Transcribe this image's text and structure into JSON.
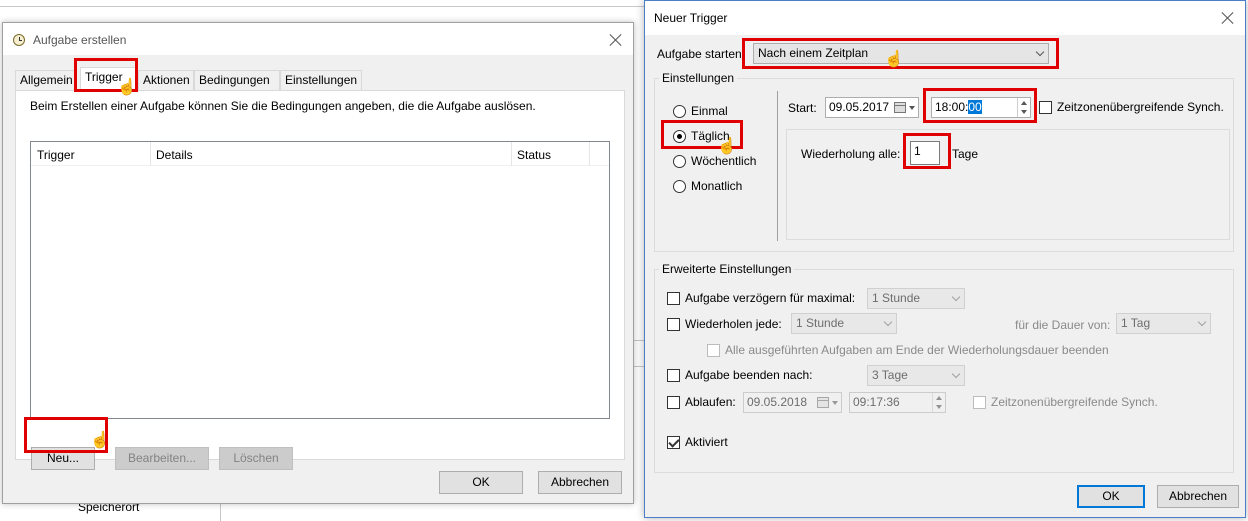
{
  "background": {
    "storage_label": "Speicherort"
  },
  "task_dialog": {
    "title": "Aufgabe erstellen",
    "tabs": [
      "Allgemein",
      "Trigger",
      "Aktionen",
      "Bedingungen",
      "Einstellungen"
    ],
    "active_tab": "Trigger",
    "description": "Beim Erstellen einer Aufgabe können Sie die Bedingungen angeben, die die Aufgabe auslösen.",
    "columns": [
      "Trigger",
      "Details",
      "Status"
    ],
    "buttons": {
      "new": "Neu...",
      "edit": "Bearbeiten...",
      "delete": "Löschen",
      "ok": "OK",
      "cancel": "Abbrechen"
    }
  },
  "trigger_dialog": {
    "title": "Neuer Trigger",
    "start_task_label": "Aufgabe starten:",
    "start_task_value": "Nach einem Zeitplan",
    "settings_group": "Einstellungen",
    "schedule_options": [
      "Einmal",
      "Täglich",
      "Wöchentlich",
      "Monatlich"
    ],
    "selected_schedule": "Täglich",
    "start_label": "Start:",
    "start_date": "09.05.2017",
    "start_time_prefix": "18:00:",
    "start_time_selected": "00",
    "sync_timezones_label": "Zeitzonenübergreifende Synch.",
    "repeat_every_label": "Wiederholung alle:",
    "repeat_every_value": "1",
    "repeat_unit": "Tage",
    "advanced_group": "Erweiterte Einstellungen",
    "delay_label": "Aufgabe verzögern für maximal:",
    "delay_value": "1 Stunde",
    "repeat_label": "Wiederholen jede:",
    "repeat_value": "1 Stunde",
    "duration_label": "für die Dauer von:",
    "duration_value": "1 Tag",
    "stop_all_label": "Alle ausgeführten Aufgaben am Ende der Wiederholungsdauer beenden",
    "stop_after_label": "Aufgabe beenden nach:",
    "stop_after_value": "3 Tage",
    "expire_label": "Ablaufen:",
    "expire_date": "09.05.2018",
    "expire_time": "09:17:36",
    "expire_sync_label": "Zeitzonenübergreifende Synch.",
    "enabled_label": "Aktiviert",
    "enabled": true,
    "ok": "OK",
    "cancel": "Abbrechen"
  },
  "colors": {
    "highlight_red": "#e00000",
    "selection_blue": "#0078d7",
    "dialog_bg": "#f0f0f0"
  }
}
